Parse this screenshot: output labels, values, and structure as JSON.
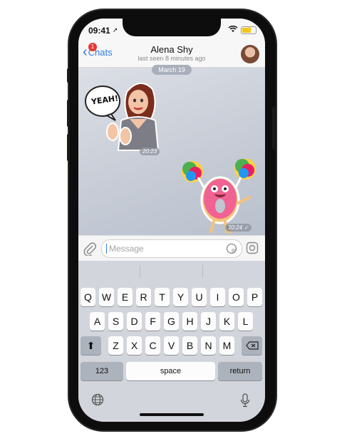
{
  "status": {
    "time": "09:41"
  },
  "header": {
    "back_label": "Chats",
    "unread_badge": "1",
    "title": "Alena Shy",
    "subtitle": "last seen 8 minutes ago"
  },
  "chat": {
    "date": "March 19",
    "messages": [
      {
        "type": "sticker",
        "sticker_text": "YEAH!",
        "time": "20:23",
        "direction": "incoming"
      },
      {
        "type": "sticker",
        "time": "20:24 ✓",
        "direction": "outgoing"
      }
    ]
  },
  "composer": {
    "placeholder": "Message"
  },
  "keyboard": {
    "row1": [
      "Q",
      "W",
      "E",
      "R",
      "T",
      "Y",
      "U",
      "I",
      "O",
      "P"
    ],
    "row2": [
      "A",
      "S",
      "D",
      "F",
      "G",
      "H",
      "J",
      "K",
      "L"
    ],
    "row3": [
      "Z",
      "X",
      "C",
      "V",
      "B",
      "N",
      "M"
    ],
    "numbers_label": "123",
    "space_label": "space",
    "return_label": "return"
  },
  "colors": {
    "accent": "#2f7de1",
    "badge": "#e53935"
  }
}
